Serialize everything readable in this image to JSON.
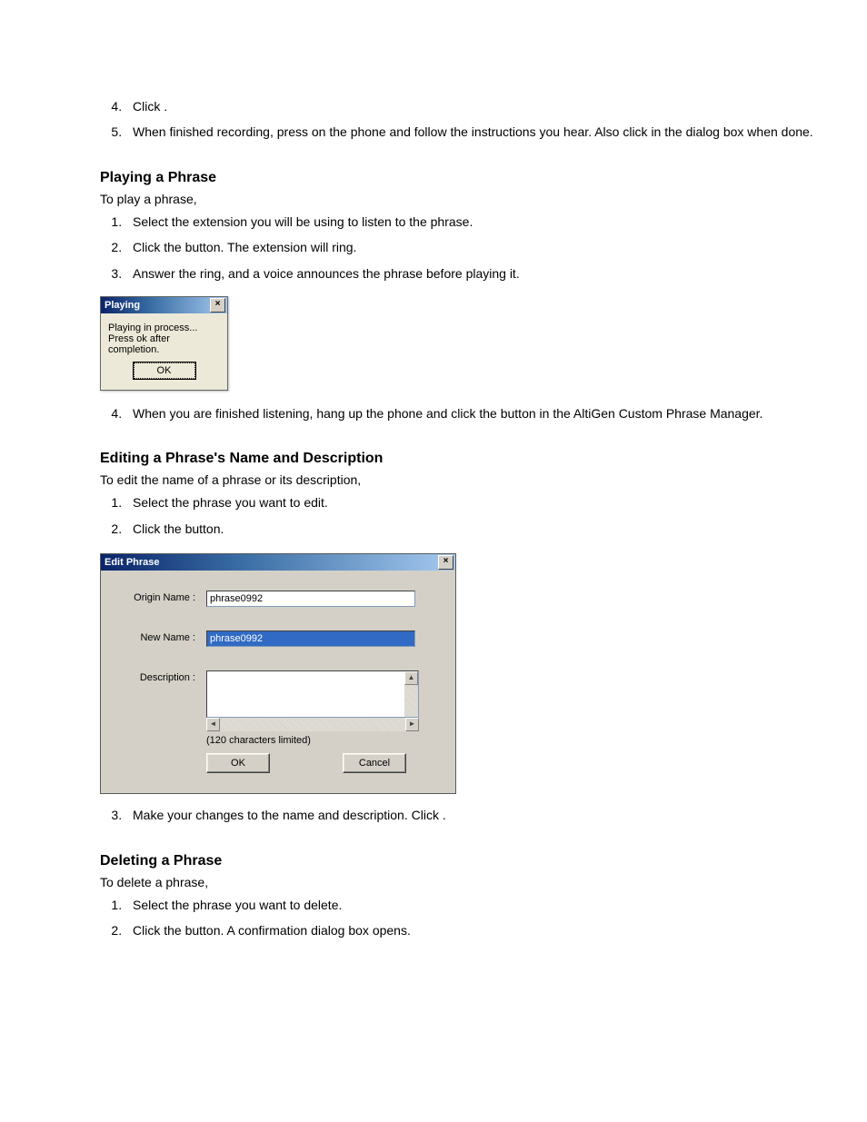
{
  "intro_list": {
    "start": 4,
    "items": [
      "Click                          .",
      "When finished recording, press      on the phone and follow the instructions you hear. Also click          in the dialog box when done."
    ]
  },
  "play_section": {
    "heading": "Playing a Phrase",
    "lead": "To play a phrase,",
    "steps": [
      "Select the extension you will be using to listen to the phrase.",
      "Click the           button. The extension will ring.",
      "Answer the ring, and a voice announces the phrase before playing it."
    ],
    "step4": "When you are finished listening, hang up the phone and click the          button in the AltiGen Custom Phrase Manager."
  },
  "playing_dialog": {
    "title": "Playing",
    "line1": "Playing in process...",
    "line2": "Press ok after completion.",
    "ok": "OK"
  },
  "edit_section": {
    "heading": "Editing a Phrase's Name and Description",
    "lead": "To edit the name of a phrase or its description,",
    "steps": [
      "Select the phrase you want to edit.",
      "Click the         button."
    ],
    "step3": "Make your changes to the name and description. Click        ."
  },
  "edit_dialog": {
    "title": "Edit Phrase",
    "origin_label": "Origin Name :",
    "origin_value": "phrase0992",
    "new_label": "New Name :",
    "new_value": "phrase0992",
    "desc_label": "Description :",
    "limit": "(120 characters limited)",
    "ok": "OK",
    "cancel": "Cancel"
  },
  "delete_section": {
    "heading": "Deleting a Phrase",
    "lead": "To delete a phrase,",
    "steps": [
      "Select the phrase you want to delete.",
      "Click the              button. A confirmation dialog box opens."
    ]
  }
}
